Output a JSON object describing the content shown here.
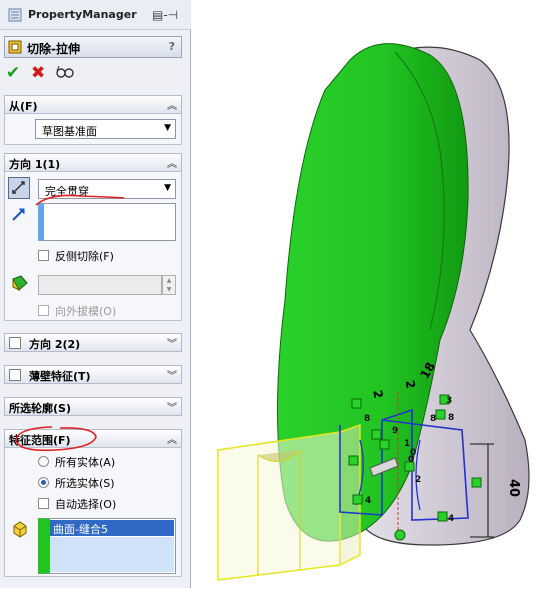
{
  "pm_title": "PropertyManager",
  "feature_title": "切除-拉伸",
  "help": "?",
  "sections": {
    "from": {
      "label": "从(F)",
      "value": "草图基准面"
    },
    "dir1": {
      "label": "方向 1(1)",
      "end_condition": "完全贯穿",
      "flip_side_label": "反侧切除(F)",
      "draft_outward_label": "向外拔模(O)"
    },
    "dir2": {
      "label": "方向 2(2)"
    },
    "thin": {
      "label": "薄壁特征(T)"
    },
    "contours": {
      "label": "所选轮廓(S)"
    },
    "scope": {
      "label": "特征范围(F)",
      "all_bodies": "所有实体(A)",
      "selected_bodies": "所选实体(S)",
      "auto_select": "自动选择(O)",
      "selected_item": "曲面-缝合5"
    }
  },
  "dims": {
    "d1": "2",
    "d2": "18",
    "d3": "2",
    "d4": "40",
    "badges": [
      "8",
      "3",
      "8",
      "9",
      "0",
      "4",
      "1",
      "2",
      "0",
      "4",
      "8"
    ]
  },
  "colors": {
    "green": "#22cc22",
    "yellow": "#e6e61e",
    "blue": "#2233cc",
    "red": "#e03020"
  }
}
